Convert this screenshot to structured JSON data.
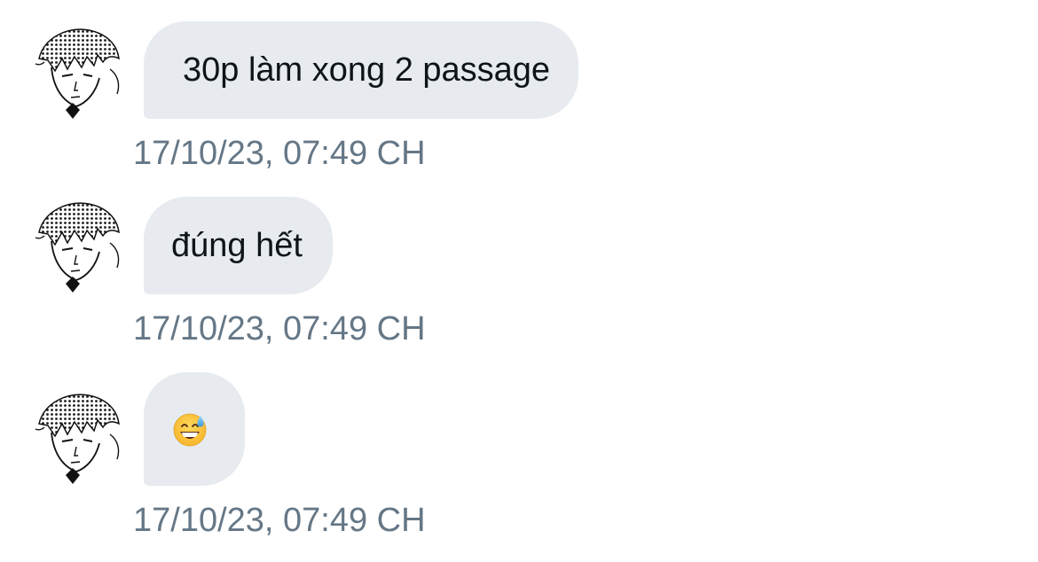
{
  "messages": [
    {
      "avatar_icon": "avatar-manga-portrait-icon",
      "text": "30p làm xong 2 passage",
      "timestamp": "17/10/23, 07:49 CH"
    },
    {
      "avatar_icon": "avatar-manga-portrait-icon",
      "text": "đúng hết",
      "timestamp": "17/10/23, 07:49 CH"
    },
    {
      "avatar_icon": "avatar-manga-portrait-icon",
      "emoji_icon": "grinning-face-with-sweat-icon",
      "timestamp": "17/10/23, 07:49 CH"
    }
  ],
  "colors": {
    "bubble_background": "#e7ebef",
    "message_text": "#0f1419",
    "timestamp_text": "#657786",
    "page_background": "#ffffff"
  }
}
